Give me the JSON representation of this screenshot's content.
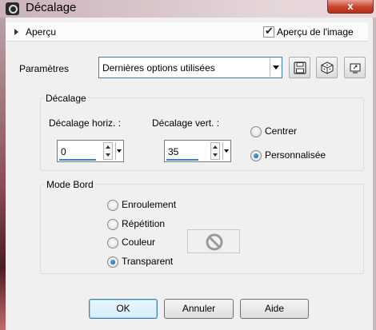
{
  "window": {
    "title": "Décalage",
    "close_label": "x"
  },
  "preview": {
    "label": "Aperçu",
    "checkbox_label": "Aperçu de l'image",
    "checked": true
  },
  "params": {
    "label": "Paramètres",
    "preset_value": "Dernières options utilisées"
  },
  "toolbar_icons": [
    "save-icon",
    "dice-icon",
    "reset-icon"
  ],
  "decalage": {
    "group_title": "Décalage",
    "horiz_label": "Décalage horiz. :",
    "horiz_value": "0",
    "vert_label": "Décalage vert. :",
    "vert_value": "35",
    "options": [
      {
        "label": "Centrer",
        "checked": false
      },
      {
        "label": "Personnalisée",
        "checked": true
      }
    ]
  },
  "mode_bord": {
    "group_title": "Mode Bord",
    "options": [
      {
        "label": "Enroulement",
        "checked": false
      },
      {
        "label": "Répétition",
        "checked": false
      },
      {
        "label": "Couleur",
        "checked": false
      },
      {
        "label": "Transparent",
        "checked": true
      }
    ],
    "color_swatch_icon": "no-color-icon"
  },
  "buttons": {
    "ok": "OK",
    "cancel": "Annuler",
    "help": "Aide"
  },
  "colors": {
    "accent": "#3c7fb1",
    "title_bar": "#d8c6c9",
    "close": "#c7432b"
  }
}
